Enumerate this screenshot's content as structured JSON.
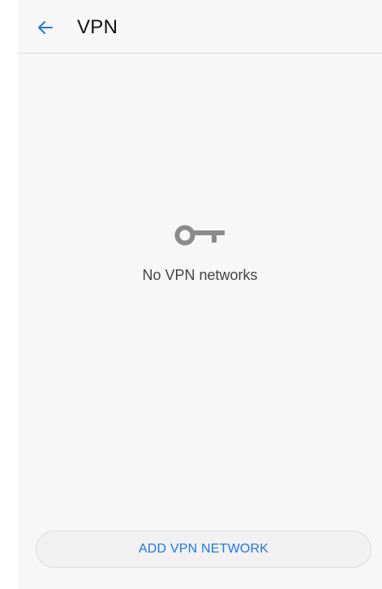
{
  "header": {
    "title": "VPN",
    "back_icon": "arrow-back-icon"
  },
  "empty_state": {
    "icon": "key-icon",
    "message": "No VPN networks"
  },
  "actions": {
    "add_label": "ADD VPN NETWORK"
  },
  "colors": {
    "accent": "#1f77e6",
    "background": "#f7f7f7",
    "icon_gray": "#8a8a8a"
  }
}
